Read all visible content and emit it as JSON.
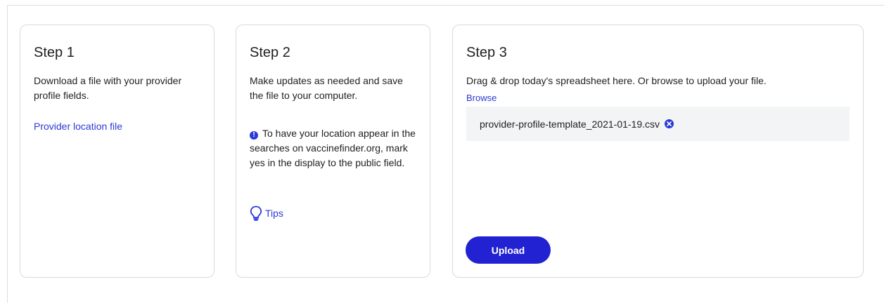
{
  "steps": {
    "step1": {
      "title": "Step 1",
      "description": "Download a file with your provider profile fields.",
      "link_label": "Provider location file"
    },
    "step2": {
      "title": "Step 2",
      "description": "Make updates as needed and save the file to your computer.",
      "info_icon": "info-icon",
      "info_text": "To have your location appear in the searches on vaccinefinder.org, mark yes in the display to the public field.",
      "tips_icon": "lightbulb-icon",
      "tips_label": "Tips"
    },
    "step3": {
      "title": "Step 3",
      "instructions": "Drag & drop today's spreadsheet here. Or browse to upload your file.",
      "browse_label": "Browse",
      "file_name": "provider-profile-template_2021-01-19.csv",
      "remove_icon": "close-circle-icon",
      "upload_label": "Upload"
    }
  },
  "colors": {
    "accent": "#2a3ad8",
    "button": "#2222d2",
    "border": "#d6d9df",
    "dropzone_bg": "#f3f4f6"
  }
}
